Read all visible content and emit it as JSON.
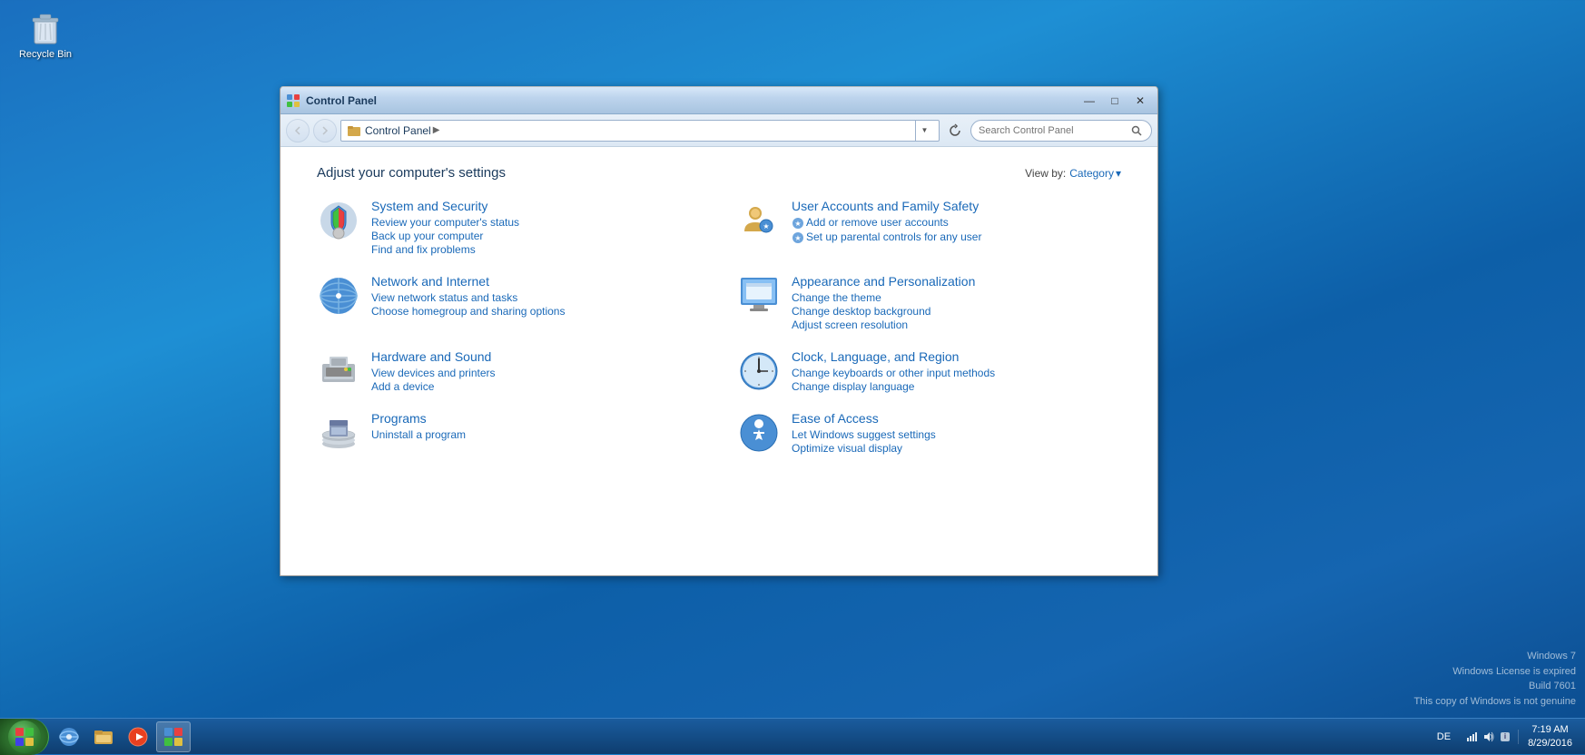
{
  "desktop": {
    "icons": [
      {
        "id": "recycle-bin",
        "label": "Recycle Bin"
      }
    ]
  },
  "window": {
    "title": "Control Panel",
    "titlebar_buttons": {
      "minimize": "—",
      "maximize": "□",
      "close": "✕"
    },
    "navbar": {
      "back_title": "Back",
      "forward_title": "Forward",
      "address": "Control Panel",
      "search_placeholder": "Search Control Panel"
    },
    "content": {
      "heading": "Adjust your computer's settings",
      "view_by_label": "View by:",
      "view_by_value": "Category",
      "categories": [
        {
          "id": "system-security",
          "title": "System and Security",
          "links": [
            "Review your computer's status",
            "Back up your computer",
            "Find and fix problems"
          ]
        },
        {
          "id": "user-accounts",
          "title": "User Accounts and Family Safety",
          "links": [
            "Add or remove user accounts",
            "Set up parental controls for any user"
          ]
        },
        {
          "id": "network-internet",
          "title": "Network and Internet",
          "links": [
            "View network status and tasks",
            "Choose homegroup and sharing options"
          ]
        },
        {
          "id": "appearance",
          "title": "Appearance and Personalization",
          "links": [
            "Change the theme",
            "Change desktop background",
            "Adjust screen resolution"
          ]
        },
        {
          "id": "hardware-sound",
          "title": "Hardware and Sound",
          "links": [
            "View devices and printers",
            "Add a device"
          ]
        },
        {
          "id": "clock-language",
          "title": "Clock, Language, and Region",
          "links": [
            "Change keyboards or other input methods",
            "Change display language"
          ]
        },
        {
          "id": "programs",
          "title": "Programs",
          "links": [
            "Uninstall a program"
          ]
        },
        {
          "id": "ease-access",
          "title": "Ease of Access",
          "links": [
            "Let Windows suggest settings",
            "Optimize visual display"
          ]
        }
      ]
    }
  },
  "taskbar": {
    "start_label": "Start",
    "items": [
      {
        "id": "ie",
        "title": "Internet Explorer"
      },
      {
        "id": "explorer",
        "title": "Windows Explorer"
      },
      {
        "id": "media",
        "title": "Windows Media Player"
      },
      {
        "id": "control-panel",
        "title": "Control Panel"
      }
    ],
    "tray": {
      "language": "DE",
      "time": "7:19 AM",
      "date": "8/29/2016"
    }
  },
  "watermark": {
    "line1": "Windows 7",
    "line2": "Windows License is expired",
    "line3": "Build 7601",
    "line4": "This copy of Windows is not genuine"
  }
}
